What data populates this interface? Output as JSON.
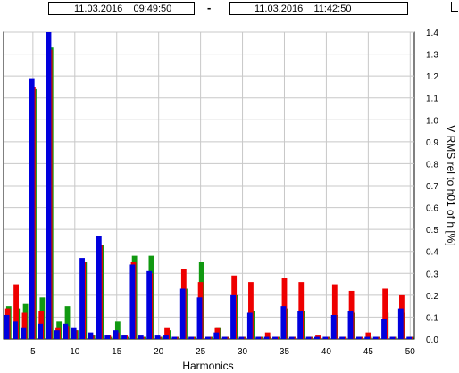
{
  "header": {
    "start_time": "11.03.2016    09:49:50",
    "separator": "-",
    "end_time": "11.03.2016    11:42:50"
  },
  "chart_data": {
    "type": "bar",
    "xlabel": "Harmonics",
    "ylabel": "V RMS rel to h01 of h [%]",
    "x_ticks": [
      5,
      10,
      15,
      20,
      25,
      30,
      35,
      40,
      45,
      50
    ],
    "y_ticks": [
      0,
      0.1,
      0.2,
      0.3,
      0.4,
      0.5,
      0.6,
      0.7,
      0.8,
      0.9,
      1.0,
      1.1,
      1.2,
      1.3,
      1.4
    ],
    "y_tick_labels": [
      "0.0",
      "0.1",
      "0.2",
      "0.3",
      "0.4",
      "0.5",
      "0.6",
      "0.7",
      "0.8",
      "0.9",
      "1.0",
      "1.1",
      "1.2",
      "1.3",
      "1.4"
    ],
    "xlim": [
      1.5,
      50.5
    ],
    "ylim": [
      0,
      1.4
    ],
    "grid": true,
    "categories": [
      2,
      3,
      4,
      5,
      6,
      7,
      8,
      9,
      10,
      11,
      12,
      13,
      14,
      15,
      16,
      17,
      18,
      19,
      20,
      21,
      22,
      23,
      24,
      25,
      26,
      27,
      28,
      29,
      30,
      31,
      32,
      33,
      34,
      35,
      36,
      37,
      38,
      39,
      40,
      41,
      42,
      43,
      44,
      45,
      46,
      47,
      48,
      49,
      50
    ],
    "series": [
      {
        "color": "#0000dd",
        "values": [
          0.11,
          0.08,
          0.05,
          1.19,
          0.07,
          1.4,
          0.04,
          0.07,
          0.05,
          0.37,
          0.03,
          0.47,
          0.02,
          0.04,
          0.02,
          0.34,
          0.02,
          0.31,
          0.02,
          0.02,
          0.01,
          0.23,
          0.01,
          0.19,
          0.01,
          0.03,
          0.01,
          0.2,
          0.01,
          0.12,
          0.01,
          0.01,
          0.01,
          0.15,
          0.01,
          0.13,
          0.01,
          0.01,
          0.01,
          0.11,
          0.01,
          0.13,
          0.01,
          0.01,
          0.01,
          0.09,
          0.01,
          0.14,
          0.01
        ]
      },
      {
        "color": "#ee0000",
        "values": [
          0.14,
          0.25,
          0.12,
          1.15,
          0.13,
          1.32,
          0.05,
          0.06,
          0.04,
          0.35,
          0.02,
          0.43,
          0.02,
          0.03,
          0.02,
          0.35,
          0.01,
          0.3,
          0.01,
          0.05,
          0.01,
          0.32,
          0.01,
          0.26,
          0.01,
          0.05,
          0.01,
          0.29,
          0.01,
          0.26,
          0.01,
          0.03,
          0.01,
          0.28,
          0.01,
          0.26,
          0.01,
          0.02,
          0.01,
          0.25,
          0.01,
          0.22,
          0.01,
          0.03,
          0.01,
          0.23,
          0.01,
          0.2,
          0.01
        ]
      },
      {
        "color": "#119911",
        "values": [
          0.15,
          0.14,
          0.16,
          1.14,
          0.19,
          1.33,
          0.08,
          0.15,
          0.04,
          0.35,
          0.02,
          0.43,
          0.01,
          0.08,
          0.01,
          0.38,
          0.01,
          0.38,
          0.01,
          0.04,
          0.01,
          0.23,
          0.01,
          0.35,
          0.01,
          0.05,
          0.01,
          0.2,
          0.01,
          0.13,
          0.01,
          0.01,
          0.01,
          0.14,
          0.01,
          0.13,
          0.01,
          0.01,
          0.01,
          0.11,
          0.01,
          0.12,
          0.01,
          0.01,
          0.01,
          0.12,
          0.01,
          0.12,
          0.01
        ]
      }
    ]
  }
}
